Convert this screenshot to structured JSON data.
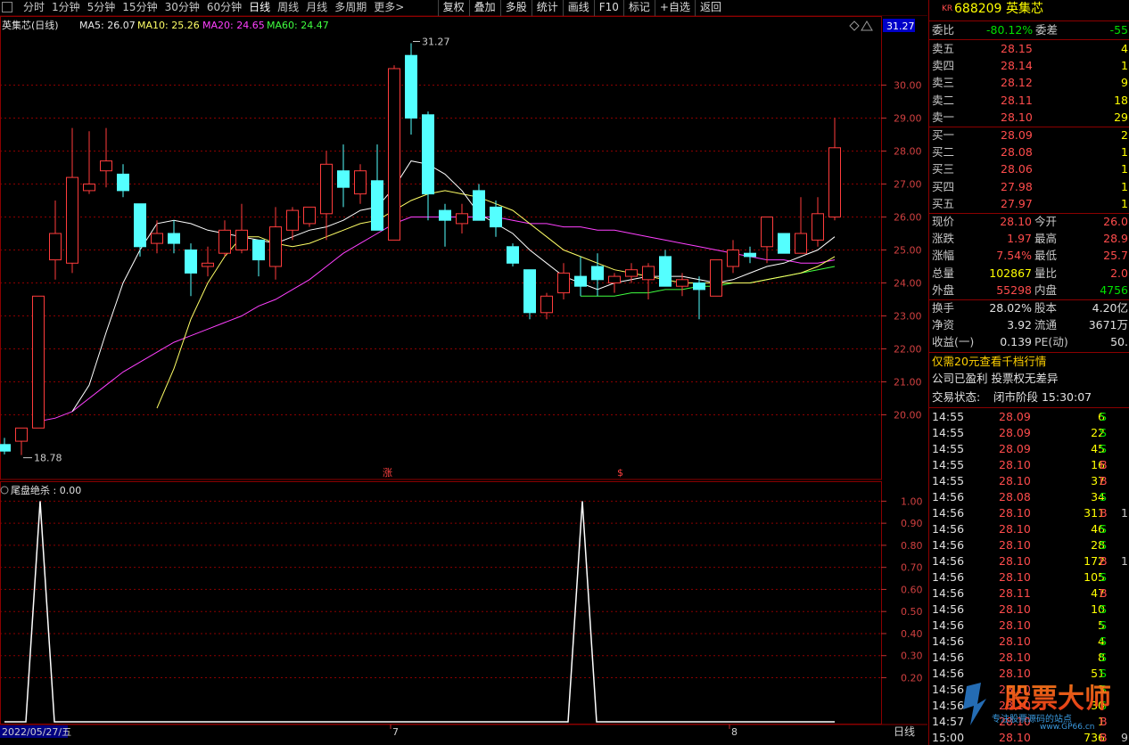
{
  "toolbar": {
    "tabs": [
      "分时",
      "1分钟",
      "5分钟",
      "15分钟",
      "30分钟",
      "60分钟",
      "日线",
      "周线",
      "月线",
      "多周期",
      "更多>"
    ],
    "active_tab": "日线",
    "right_tools": [
      "复权",
      "叠加",
      "多股",
      "统计",
      "画线",
      "F10",
      "标记",
      "+自选",
      "返回"
    ]
  },
  "main_chart": {
    "title": "英集芯(日线)",
    "ma5": "MA5: 26.07",
    "ma10": "MA10: 25.26",
    "ma20": "MA20: 24.65",
    "ma60": "MA60: 24.47",
    "current_price_tag": "31.27",
    "high_label": "31.27",
    "low_label": "18.78",
    "y_ticks": [
      "30.00",
      "29.00",
      "28.00",
      "27.00",
      "26.00",
      "25.00",
      "24.00",
      "23.00",
      "22.00",
      "21.00",
      "20.00"
    ],
    "markers": [
      "涨",
      "$"
    ],
    "colors": {
      "up": "#ff3c3c",
      "down": "#54ffff",
      "ma5": "#ffffff",
      "ma10": "#ffff66",
      "ma20": "#ff40ff",
      "ma60": "#40ff40"
    }
  },
  "chart_data": {
    "type": "candlestick",
    "ylim": [
      18.5,
      31.5
    ],
    "candles": [
      {
        "o": 19.1,
        "h": 19.3,
        "l": 18.8,
        "c": 18.9
      },
      {
        "o": 19.2,
        "h": 19.5,
        "l": 18.78,
        "c": 19.6
      },
      {
        "o": 19.6,
        "h": 23.6,
        "l": 19.6,
        "c": 23.6
      },
      {
        "o": 24.7,
        "h": 26.5,
        "l": 24.1,
        "c": 25.5
      },
      {
        "o": 24.6,
        "h": 28.7,
        "l": 24.3,
        "c": 27.2
      },
      {
        "o": 26.8,
        "h": 28.6,
        "l": 26.7,
        "c": 27.0
      },
      {
        "o": 27.4,
        "h": 28.7,
        "l": 26.9,
        "c": 27.7
      },
      {
        "o": 27.3,
        "h": 27.6,
        "l": 26.6,
        "c": 26.8
      },
      {
        "o": 26.4,
        "h": 26.4,
        "l": 24.8,
        "c": 25.1
      },
      {
        "o": 25.2,
        "h": 25.9,
        "l": 24.9,
        "c": 25.5
      },
      {
        "o": 25.5,
        "h": 25.9,
        "l": 24.9,
        "c": 25.2
      },
      {
        "o": 25.0,
        "h": 25.2,
        "l": 23.6,
        "c": 24.3
      },
      {
        "o": 24.5,
        "h": 25.1,
        "l": 24.2,
        "c": 24.6
      },
      {
        "o": 24.9,
        "h": 25.9,
        "l": 24.8,
        "c": 25.6
      },
      {
        "o": 25.0,
        "h": 26.4,
        "l": 24.9,
        "c": 25.6
      },
      {
        "o": 25.3,
        "h": 25.3,
        "l": 24.2,
        "c": 24.7
      },
      {
        "o": 24.5,
        "h": 26.3,
        "l": 24.1,
        "c": 25.7
      },
      {
        "o": 25.6,
        "h": 26.3,
        "l": 25.3,
        "c": 26.2
      },
      {
        "o": 25.8,
        "h": 26.3,
        "l": 25.7,
        "c": 26.3
      },
      {
        "o": 26.1,
        "h": 28.0,
        "l": 25.3,
        "c": 27.6
      },
      {
        "o": 27.4,
        "h": 28.2,
        "l": 26.3,
        "c": 26.9
      },
      {
        "o": 26.7,
        "h": 27.6,
        "l": 26.4,
        "c": 27.4
      },
      {
        "o": 27.1,
        "h": 28.2,
        "l": 25.6,
        "c": 25.6
      },
      {
        "o": 25.3,
        "h": 30.6,
        "l": 25.3,
        "c": 30.5
      },
      {
        "o": 30.9,
        "h": 31.27,
        "l": 28.5,
        "c": 29.0
      },
      {
        "o": 29.1,
        "h": 29.2,
        "l": 25.9,
        "c": 26.7
      },
      {
        "o": 26.2,
        "h": 26.4,
        "l": 25.1,
        "c": 25.9
      },
      {
        "o": 25.8,
        "h": 26.4,
        "l": 25.5,
        "c": 26.1
      },
      {
        "o": 26.8,
        "h": 27.0,
        "l": 25.9,
        "c": 25.9
      },
      {
        "o": 26.3,
        "h": 26.5,
        "l": 25.4,
        "c": 25.7
      },
      {
        "o": 25.1,
        "h": 25.2,
        "l": 24.5,
        "c": 24.6
      },
      {
        "o": 24.4,
        "h": 24.4,
        "l": 22.9,
        "c": 23.1
      },
      {
        "o": 23.1,
        "h": 23.7,
        "l": 22.9,
        "c": 23.6
      },
      {
        "o": 23.7,
        "h": 24.6,
        "l": 23.5,
        "c": 24.3
      },
      {
        "o": 24.2,
        "h": 24.8,
        "l": 23.6,
        "c": 23.9
      },
      {
        "o": 24.5,
        "h": 24.9,
        "l": 23.6,
        "c": 24.1
      },
      {
        "o": 24.0,
        "h": 24.3,
        "l": 23.7,
        "c": 24.2
      },
      {
        "o": 24.2,
        "h": 24.6,
        "l": 24.0,
        "c": 24.4
      },
      {
        "o": 24.1,
        "h": 24.6,
        "l": 23.5,
        "c": 24.5
      },
      {
        "o": 24.8,
        "h": 25.0,
        "l": 23.9,
        "c": 23.9
      },
      {
        "o": 23.9,
        "h": 24.3,
        "l": 23.6,
        "c": 24.1
      },
      {
        "o": 24.0,
        "h": 24.2,
        "l": 22.9,
        "c": 23.8
      },
      {
        "o": 23.6,
        "h": 24.7,
        "l": 23.6,
        "c": 24.7
      },
      {
        "o": 24.5,
        "h": 25.3,
        "l": 24.3,
        "c": 25.0
      },
      {
        "o": 24.9,
        "h": 25.1,
        "l": 24.6,
        "c": 24.8
      },
      {
        "o": 25.1,
        "h": 26.0,
        "l": 24.6,
        "c": 26.0
      },
      {
        "o": 25.5,
        "h": 25.5,
        "l": 24.9,
        "c": 24.9
      },
      {
        "o": 24.9,
        "h": 26.6,
        "l": 24.9,
        "c": 25.5
      },
      {
        "o": 25.3,
        "h": 26.6,
        "l": 25.1,
        "c": 26.1
      },
      {
        "o": 26.0,
        "h": 29.0,
        "l": 25.9,
        "c": 28.1
      }
    ],
    "ma5": [
      null,
      null,
      null,
      null,
      20.1,
      20.9,
      22.5,
      24.0,
      25.0,
      25.8,
      25.9,
      25.8,
      25.6,
      25.5,
      25.4,
      25.3,
      25.2,
      25.4,
      25.6,
      25.7,
      25.9,
      26.2,
      26.3,
      26.9,
      27.7,
      27.6,
      27.3,
      26.8,
      26.1,
      25.8,
      25.5,
      25.0,
      24.6,
      24.2,
      24.0,
      23.8,
      24.0,
      24.1,
      24.2,
      24.2,
      24.2,
      24.1,
      24.0,
      24.1,
      24.3,
      24.5,
      24.6,
      24.8,
      25.0,
      25.4
    ],
    "ma10": [
      null,
      null,
      null,
      null,
      null,
      null,
      null,
      null,
      null,
      20.2,
      21.4,
      22.9,
      24.0,
      24.8,
      25.4,
      25.4,
      25.2,
      25.1,
      25.2,
      25.4,
      25.6,
      25.8,
      25.9,
      26.2,
      26.5,
      26.7,
      26.8,
      26.7,
      26.6,
      26.4,
      26.2,
      25.8,
      25.4,
      25.0,
      24.8,
      24.6,
      24.4,
      24.3,
      24.2,
      24.1,
      24.0,
      24.0,
      24.0,
      24.0,
      24.0,
      24.1,
      24.2,
      24.3,
      24.5,
      24.8
    ],
    "ma20": [
      null,
      null,
      19.8,
      19.9,
      20.1,
      20.5,
      20.9,
      21.3,
      21.6,
      21.9,
      22.2,
      22.4,
      22.6,
      22.8,
      23.0,
      23.3,
      23.5,
      23.8,
      24.1,
      24.5,
      24.9,
      25.2,
      25.5,
      25.8,
      26.0,
      26.0,
      26.0,
      26.0,
      26.0,
      26.0,
      25.9,
      25.8,
      25.8,
      25.7,
      25.7,
      25.6,
      25.6,
      25.5,
      25.4,
      25.3,
      25.2,
      25.1,
      25.0,
      24.9,
      24.8,
      24.7,
      24.7,
      24.6,
      24.6,
      24.7
    ],
    "ma60": [
      null,
      null,
      null,
      null,
      null,
      null,
      null,
      null,
      null,
      null,
      null,
      null,
      null,
      null,
      null,
      null,
      null,
      null,
      null,
      null,
      null,
      null,
      null,
      null,
      null,
      null,
      null,
      null,
      null,
      null,
      null,
      null,
      null,
      null,
      23.6,
      23.6,
      23.6,
      23.7,
      23.7,
      23.8,
      23.8,
      23.9,
      23.9,
      24.0,
      24.0,
      24.1,
      24.2,
      24.3,
      24.4,
      24.5
    ],
    "x_labels": [
      {
        "index": 0,
        "text": "2022/05/27/五"
      },
      {
        "index": 23,
        "text": "7"
      },
      {
        "index": 43,
        "text": "8"
      }
    ],
    "indicator": {
      "name": "尾盘绝杀",
      "value_label": "尾盘绝杀 : 0.00",
      "y_ticks": [
        "1.00",
        "0.90",
        "0.80",
        "0.70",
        "0.60",
        "0.50",
        "0.40",
        "0.30",
        "0.20"
      ],
      "ylim": [
        0,
        1.05
      ],
      "values": [
        0,
        0,
        1,
        0,
        0,
        0,
        0,
        0,
        0,
        0,
        0,
        0,
        0,
        0,
        0,
        0,
        0,
        0,
        0,
        0,
        0,
        0,
        0,
        0,
        0,
        0,
        0,
        0,
        0,
        0,
        0,
        0,
        0,
        0,
        1,
        0,
        0,
        0,
        0,
        0,
        0,
        0,
        0,
        0,
        0,
        0,
        0,
        0,
        0,
        0
      ]
    }
  },
  "bottom": {
    "period_label": "日线"
  },
  "quote": {
    "code": "688209",
    "name": "英集芯",
    "kr_tag": "KR",
    "weibi_label": "委比",
    "weibi_value": "-80.12%",
    "weicha_label": "委差",
    "weicha_value": "-55",
    "sells": [
      {
        "label": "卖五",
        "price": "28.15",
        "vol": "4"
      },
      {
        "label": "卖四",
        "price": "28.14",
        "vol": "1"
      },
      {
        "label": "卖三",
        "price": "28.12",
        "vol": "9"
      },
      {
        "label": "卖二",
        "price": "28.11",
        "vol": "18"
      },
      {
        "label": "卖一",
        "price": "28.10",
        "vol": "29"
      }
    ],
    "buys": [
      {
        "label": "买一",
        "price": "28.09",
        "vol": "2"
      },
      {
        "label": "买二",
        "price": "28.08",
        "vol": "1"
      },
      {
        "label": "买三",
        "price": "28.06",
        "vol": "1"
      },
      {
        "label": "买四",
        "price": "27.98",
        "vol": "1"
      },
      {
        "label": "买五",
        "price": "27.97",
        "vol": "1"
      }
    ],
    "stats": [
      {
        "l1": "现价",
        "v1": "28.10",
        "l2": "今开",
        "v2": "26.0"
      },
      {
        "l1": "涨跌",
        "v1": "1.97",
        "l2": "最高",
        "v2": "28.9"
      },
      {
        "l1": "涨幅",
        "v1": "7.54%",
        "l2": "最低",
        "v2": "25.7"
      },
      {
        "l1": "总量",
        "v1": "102867",
        "l2": "量比",
        "v2": "2.0"
      },
      {
        "l1": "外盘",
        "v1": "55298",
        "l2": "内盘",
        "v2": "4756"
      }
    ],
    "stats2": [
      {
        "l1": "换手",
        "v1": "28.02%",
        "l2": "股本",
        "v2": "4.20亿"
      },
      {
        "l1": "净资",
        "v1": "3.92",
        "l2": "流通",
        "v2": "3671万"
      },
      {
        "l1": "收益(一)",
        "v1": "0.139",
        "l2": "PE(动)",
        "v2": "50."
      }
    ],
    "ad_line": "仅需20元查看千档行情",
    "info_line": "公司已盈利 投票权无差异",
    "status_label": "交易状态:",
    "status_value": "闭市阶段 15:30:07"
  },
  "ticks": [
    {
      "t": "14:55",
      "p": "28.09",
      "v": "6",
      "s": "S",
      "x": ""
    },
    {
      "t": "14:55",
      "p": "28.09",
      "v": "22",
      "s": "S",
      "x": ""
    },
    {
      "t": "14:55",
      "p": "28.09",
      "v": "45",
      "s": "S",
      "x": ""
    },
    {
      "t": "14:55",
      "p": "28.10",
      "v": "16",
      "s": "B",
      "x": ""
    },
    {
      "t": "14:55",
      "p": "28.10",
      "v": "37",
      "s": "B",
      "x": ""
    },
    {
      "t": "14:56",
      "p": "28.08",
      "v": "34",
      "s": "S",
      "x": ""
    },
    {
      "t": "14:56",
      "p": "28.10",
      "v": "311",
      "s": "B",
      "x": "1"
    },
    {
      "t": "14:56",
      "p": "28.10",
      "v": "46",
      "s": "S",
      "x": ""
    },
    {
      "t": "14:56",
      "p": "28.10",
      "v": "28",
      "s": "S",
      "x": ""
    },
    {
      "t": "14:56",
      "p": "28.10",
      "v": "172",
      "s": "B",
      "x": "1"
    },
    {
      "t": "14:56",
      "p": "28.10",
      "v": "105",
      "s": "S",
      "x": ""
    },
    {
      "t": "14:56",
      "p": "28.11",
      "v": "47",
      "s": "B",
      "x": ""
    },
    {
      "t": "14:56",
      "p": "28.10",
      "v": "10",
      "s": "S",
      "x": ""
    },
    {
      "t": "14:56",
      "p": "28.10",
      "v": "5",
      "s": "S",
      "x": ""
    },
    {
      "t": "14:56",
      "p": "28.10",
      "v": "4",
      "s": "S",
      "x": ""
    },
    {
      "t": "14:56",
      "p": "28.10",
      "v": "8",
      "s": "S",
      "x": ""
    },
    {
      "t": "14:56",
      "p": "28.10",
      "v": "51",
      "s": "S",
      "x": ""
    },
    {
      "t": "14:56",
      "p": "28.10",
      "v": "3",
      "s": "S",
      "x": ""
    },
    {
      "t": "14:56",
      "p": "28.10",
      "v": "30",
      "s": "S",
      "x": ""
    },
    {
      "t": "14:57",
      "p": "28.10",
      "v": "1",
      "s": "B",
      "x": ""
    },
    {
      "t": "15:00",
      "p": "28.10",
      "v": "736",
      "s": "B",
      "x": "9"
    }
  ],
  "watermark": {
    "title": "股票大师",
    "url": "www.GP66.cn",
    "slogan": "专注股票源码的站点"
  }
}
